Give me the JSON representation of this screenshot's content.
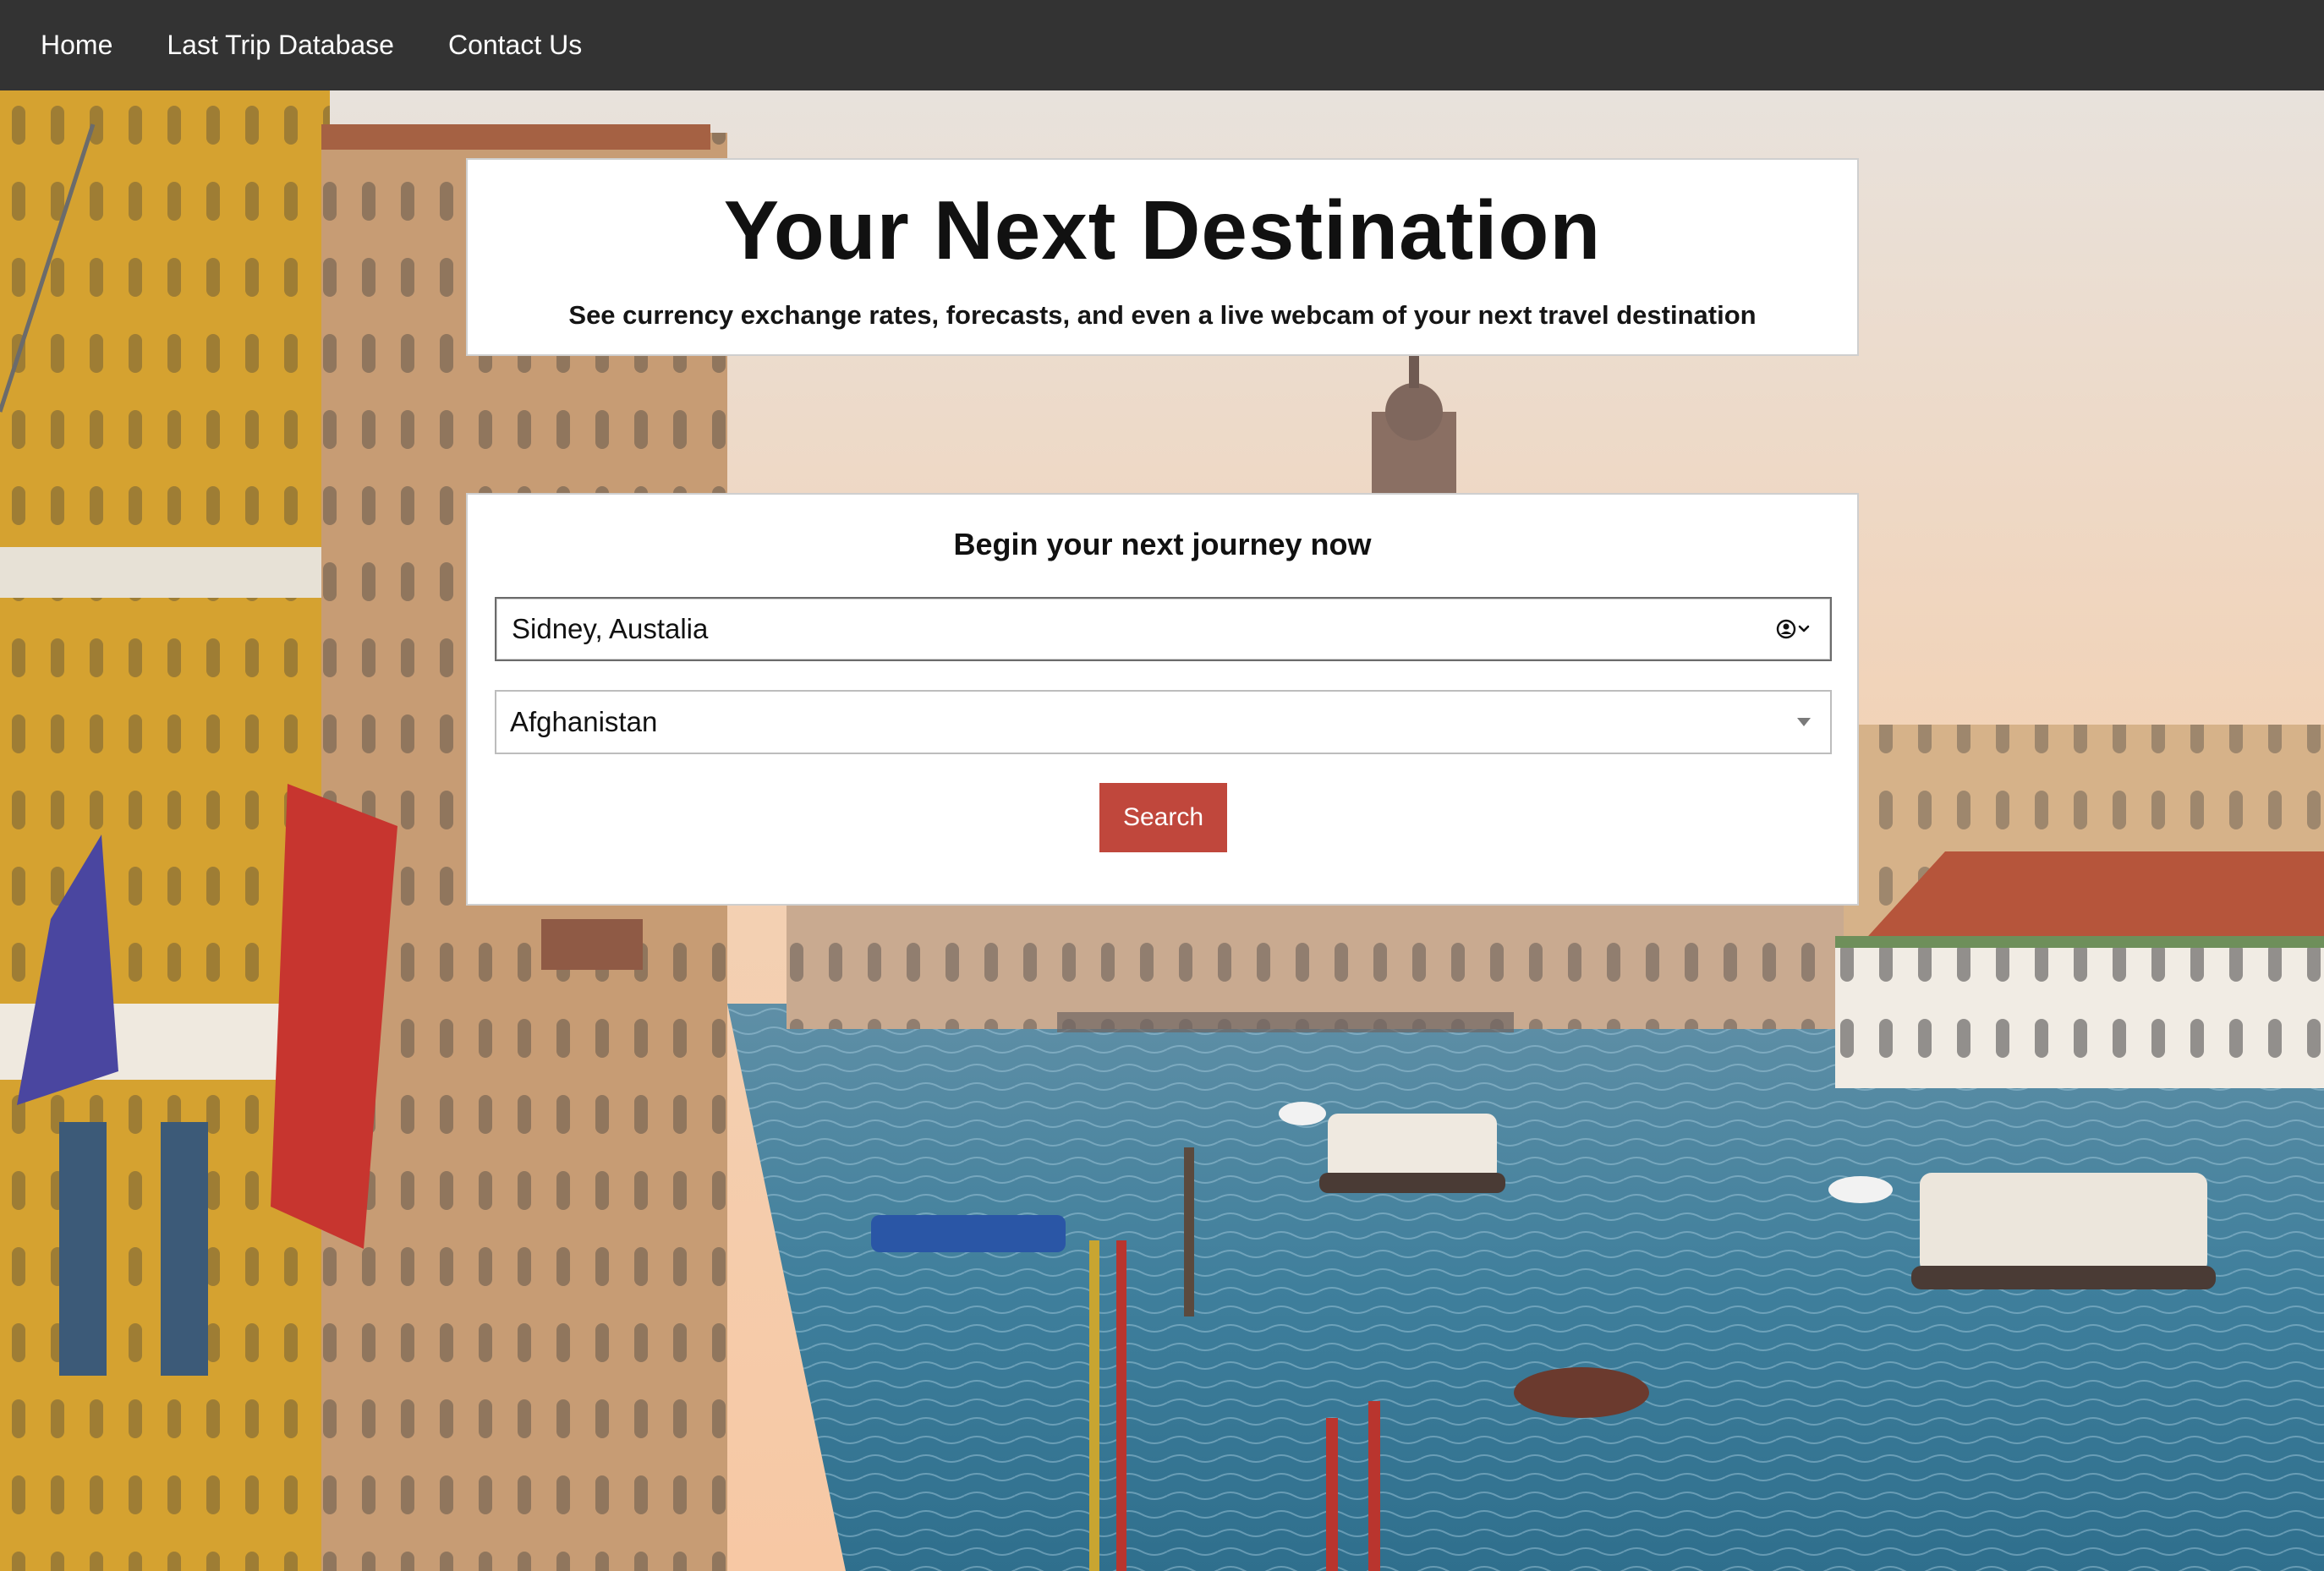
{
  "nav": {
    "items": [
      {
        "label": "Home"
      },
      {
        "label": "Last Trip Database"
      },
      {
        "label": "Contact Us"
      }
    ]
  },
  "hero": {
    "title": "Your Next Destination",
    "subtitle": "See currency exchange rates, forecasts, and even a live webcam of your next travel destination"
  },
  "search": {
    "heading": "Begin your next journey now",
    "city_value": "Sidney, Austalia",
    "country_selected": "Afghanistan",
    "button_label": "Search"
  },
  "colors": {
    "navbar": "#333333",
    "button": "#c0473c"
  },
  "icons": {
    "autofill": "contact-card-icon",
    "dropdown": "chevron-down-icon",
    "select_arrow": "caret-down-icon"
  }
}
